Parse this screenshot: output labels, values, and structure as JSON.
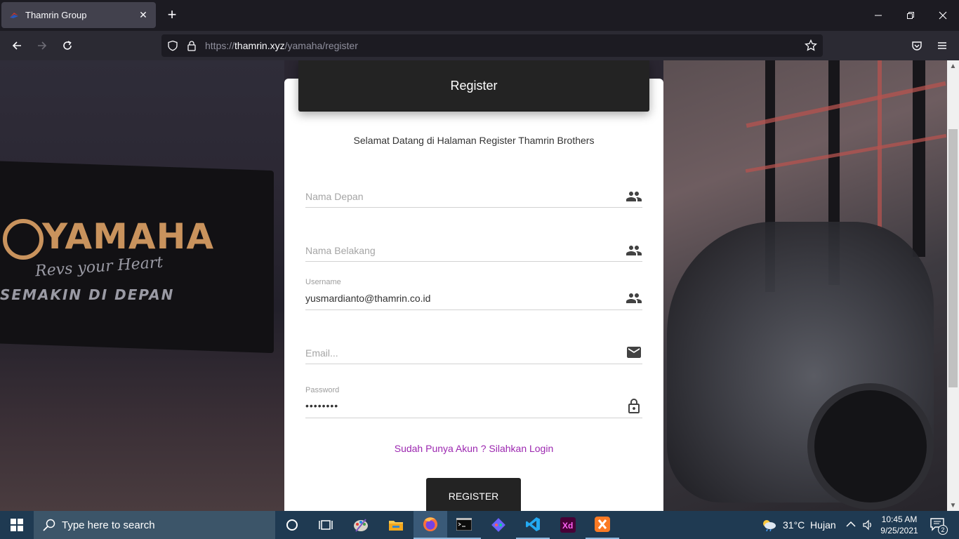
{
  "browser": {
    "tab_title": "Thamrin Group",
    "url_scheme": "https://",
    "url_host": "thamrin.xyz",
    "url_path": "/yamaha/register"
  },
  "background": {
    "brand": "YAMAHA",
    "tagline": "Revs your Heart",
    "slogan": "SEMAKIN DI DEPAN"
  },
  "form": {
    "header": "Register",
    "welcome": "Selamat Datang di Halaman Register Thamrin Brothers",
    "first_name": {
      "placeholder": "Nama Depan",
      "value": "",
      "icon": "people-icon"
    },
    "last_name": {
      "placeholder": "Nama Belakang",
      "value": "",
      "icon": "people-icon"
    },
    "username": {
      "label": "Username",
      "value": "yusmardianto@thamrin.co.id",
      "icon": "people-icon"
    },
    "email": {
      "placeholder": "Email...",
      "value": "",
      "icon": "mail-icon"
    },
    "password": {
      "label": "Password",
      "value": "••••••••",
      "icon": "lock-icon"
    },
    "login_link": "Sudah Punya Akun ? Silahkan Login",
    "register_button": "REGISTER"
  },
  "taskbar": {
    "search_placeholder": "Type here to search",
    "weather": "31°C  Hujan",
    "time": "10:45 AM",
    "date": "9/25/2021",
    "notifications": "2"
  },
  "colors": {
    "accent_link": "#9c27b0",
    "card_header": "#232323",
    "taskbar": "#1f3a52"
  }
}
